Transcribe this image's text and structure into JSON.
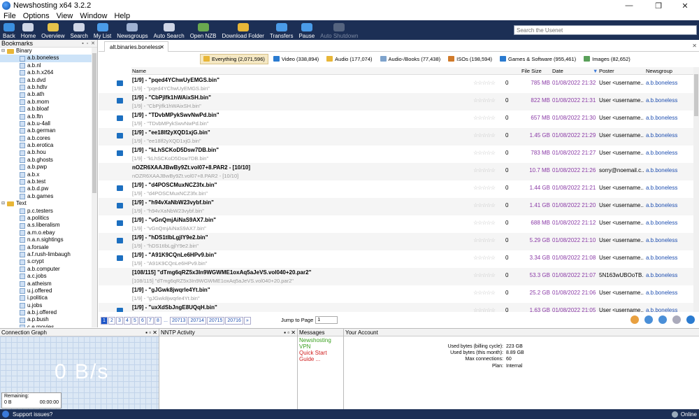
{
  "window": {
    "title": "Newshosting x64 3.2.2",
    "minimize": "—",
    "maximize": "❐",
    "close": "✕"
  },
  "menu": [
    "File",
    "Options",
    "View",
    "Window",
    "Help"
  ],
  "toolbar": {
    "buttons": [
      {
        "label": "Back",
        "color": "#3b8fe0"
      },
      {
        "label": "Home",
        "color": "#cfd6e6"
      },
      {
        "label": "Overview",
        "color": "#e6c34a"
      },
      {
        "label": "Search",
        "color": "#cfd6e6"
      },
      {
        "label": "My List",
        "color": "#4a9be8"
      },
      {
        "label": "Newsgroups",
        "color": "#9fb2d2"
      },
      {
        "label": "Auto Search",
        "color": "#cfd6e6"
      },
      {
        "label": "Open NZB",
        "color": "#6aa84f"
      },
      {
        "label": "Download Folder",
        "color": "#e6b637"
      },
      {
        "label": "Transfers",
        "color": "#4a9be8"
      },
      {
        "label": "Pause",
        "color": "#4a9be8"
      },
      {
        "label": "Auto Shutdown",
        "color": "#55647f",
        "disabled": true
      }
    ],
    "search_placeholder": "Search the Usenet"
  },
  "bookmarks": {
    "title": "Bookmarks",
    "controls": "▪ ▫ ✕",
    "groups": [
      {
        "label": "Binary",
        "toggle": "⊟",
        "items": [
          "a.b.boneless",
          "a.b.nl",
          "a.b.h.x264",
          "a.b.dvd",
          "a.b.hdtv",
          "a.b.ath",
          "a.b.mom",
          "a.b.bloaf",
          "a.b.ftn",
          "a.b.u-4all",
          "a.b.german",
          "a.b.cores",
          "a.b.erotica",
          "a.b.hou",
          "a.b.ghosts",
          "a.b.pwp",
          "a.b.x",
          "a.b.test",
          "a.b.d.pw",
          "a.b.games"
        ]
      },
      {
        "label": "Text",
        "toggle": "⊟",
        "items": [
          "p.c.testers",
          "a.politics",
          "a.s.liberalism",
          "a.m.o.ebay",
          "n.a.n.sightings",
          "a.forsale",
          "a.f.rush-limbaugh",
          "s.crypt",
          "a.b.computer",
          "a.c.jobs",
          "a.atheism",
          "u.j.offered",
          "i.politica",
          "u.jobs",
          "a.b.j.offered",
          "a.p.bush",
          "c.e.movies"
        ]
      }
    ],
    "selected": "a.b.boneless"
  },
  "tab": {
    "label": "alt.binaries.boneless",
    "close": "✕"
  },
  "filters": [
    {
      "label": "Everything (2,071,596)",
      "color": "#e8b637",
      "active": true
    },
    {
      "label": "Video (338,894)",
      "color": "#2b7bd0"
    },
    {
      "label": "Audio (177,074)",
      "color": "#e8b637"
    },
    {
      "label": "Audio-/Books (77,438)",
      "color": "#7ea3cc"
    },
    {
      "label": "ISOs (198,594)",
      "color": "#d07a2a"
    },
    {
      "label": "Games & Software (955,461)",
      "color": "#2b7bd0"
    },
    {
      "label": "Images (82,652)",
      "color": "#5aa05a"
    }
  ],
  "columns": {
    "name": "Name",
    "size": "File Size",
    "date": "Date",
    "sort": "▼",
    "poster": "Poster",
    "group": "Newsgroup"
  },
  "rows": [
    {
      "name": "[1/9] - \"pqed4YChwUyEMGS.bin\"",
      "sub": "[1/9] - \"pqed4YChwUyEMGS.bin\"",
      "count": "0",
      "size": "785 MB",
      "date": "01/08/2022 21:32",
      "poster": "User <username...",
      "group": "a.b.boneless",
      "icon": true
    },
    {
      "name": "[1/9] - \"CbPjIfk1hWAixSH.bin\"",
      "sub": "[1/9] - \"CbPjIfk1hWAixSH.bin\"",
      "count": "0",
      "size": "822 MB",
      "date": "01/08/2022 21:31",
      "poster": "User <username...",
      "group": "a.b.boneless",
      "icon": true
    },
    {
      "name": "[1/9] - \"TDvbMPykSwvNwPd.bin\"",
      "sub": "[1/9] - \"TDvbMPykSwvNwPd.bin\"",
      "count": "0",
      "size": "657 MB",
      "date": "01/08/2022 21:30",
      "poster": "User <username...",
      "group": "a.b.boneless",
      "icon": true
    },
    {
      "name": "[1/9] - \"ee18lf2yXQD1xjG.bin\"",
      "sub": "[1/9] - \"ee18lf2yXQD1xjG.bin\"",
      "count": "0",
      "size": "1.45 GB",
      "date": "01/08/2022 21:29",
      "poster": "User <username...",
      "group": "a.b.boneless",
      "icon": true
    },
    {
      "name": "[1/9] - \"kLhSCKoD5Dsw7DB.bin\"",
      "sub": "[1/9] - \"kLhSCKoD5Dsw7DB.bin\"",
      "count": "0",
      "size": "783 MB",
      "date": "01/08/2022 21:27",
      "poster": "User <username...",
      "group": "a.b.boneless",
      "icon": true
    },
    {
      "name": "nOZR6XAAJBwBy9Zt.vol07+8.PAR2 - [10/10]",
      "sub": "nOZR6XAAJBwBy9Zt.vol07+8.PAR2 - [10/10]",
      "count": "0",
      "size": "10.7 MB",
      "date": "01/08/2022 21:26",
      "poster": "sorry@noemail.c...",
      "group": "a.b.boneless",
      "icon": false
    },
    {
      "name": "[1/9] - \"d4POSCMuxNCZ3fx.bin\"",
      "sub": "[1/9] - \"d4POSCMuxNCZ3fx.bin\"",
      "count": "0",
      "size": "1.44 GB",
      "date": "01/08/2022 21:21",
      "poster": "User <username...",
      "group": "a.b.boneless",
      "icon": true
    },
    {
      "name": "[1/9] - \"h94vXaNbW23vybf.bin\"",
      "sub": "[1/9] - \"h94vXaNbW23vybf.bin\"",
      "count": "0",
      "size": "1.41 GB",
      "date": "01/08/2022 21:20",
      "poster": "User <username...",
      "group": "a.b.boneless",
      "icon": true
    },
    {
      "name": "[1/9] - \"vGnQmjAiNaS9AX7.bin\"",
      "sub": "[1/9] - \"vGnQmjAiNaS9AX7.bin\"",
      "count": "0",
      "size": "688 MB",
      "date": "01/08/2022 21:12",
      "poster": "User <username...",
      "group": "a.b.boneless",
      "icon": true
    },
    {
      "name": "[1/9] - \"hDS1tIbLgjlY9e2.bin\"",
      "sub": "[1/9] - \"hDS1tIbLgjlY9e2.bin\"",
      "count": "0",
      "size": "5.29 GB",
      "date": "01/08/2022 21:10",
      "poster": "User <username...",
      "group": "a.b.boneless",
      "icon": true
    },
    {
      "name": "[1/9] - \"A91K9CQnLe6HPv9.bin\"",
      "sub": "[1/9] - \"A91K9CQnLe6HPv9.bin\"",
      "count": "0",
      "size": "3.34 GB",
      "date": "01/08/2022 21:08",
      "poster": "User <username...",
      "group": "a.b.boneless",
      "icon": true
    },
    {
      "name": "[108/115] \"dTmg6qRZ5x3In9WGWME1oxAq5aJeVS.vol040+20.par2\"",
      "sub": "[108/115] \"dTmg6qRZ5x3In9WGWME1oxAq5aJeVS.vol040+20.par2\"",
      "count": "0",
      "size": "53.3 GB",
      "date": "01/08/2022 21:07",
      "poster": "5N163wUBOoTB...",
      "group": "a.b.boneless",
      "icon": false
    },
    {
      "name": "[1/9] - \"gJGwk8jwqrle4Yt.bin\"",
      "sub": "[1/9] - \"gJGwk8jwqrle4Yt.bin\"",
      "count": "0",
      "size": "25.2 GB",
      "date": "01/08/2022 21:06",
      "poster": "User <username...",
      "group": "a.b.boneless",
      "icon": false
    },
    {
      "name": "[1/9] - \"uxXdSbJngE8UQqH.bin\"",
      "sub": "",
      "count": "0",
      "size": "1.63 GB",
      "date": "01/08/2022 21:05",
      "poster": "User <username...",
      "group": "a.b.boneless",
      "icon": true
    }
  ],
  "pager": {
    "pages": [
      "1",
      "2",
      "3",
      "4",
      "5",
      "6",
      "7",
      "8"
    ],
    "ellipsis": "...",
    "tail": [
      "20713",
      "20714",
      "20715",
      "20716"
    ],
    "next": "»",
    "jump_label": "Jump to Page",
    "jump_value": "1"
  },
  "panes": {
    "connection": {
      "title": "Connection Graph",
      "rate": "0 B/s",
      "remaining_label": "Remaining:",
      "remaining_size": "0 B",
      "remaining_time": "00:00:00"
    },
    "nntp": {
      "title": "NNTP Activity"
    },
    "messages": {
      "title": "Messages",
      "items": [
        "Newshosting VPN",
        "Quick Start Guide ..."
      ]
    },
    "account": {
      "title": "Your Account",
      "rows": [
        {
          "k": "Used bytes (billing cycle):",
          "v": "223 GB"
        },
        {
          "k": "Used bytes (this month):",
          "v": "8.89 GB"
        },
        {
          "k": "Max connections:",
          "v": "60"
        },
        {
          "k": "Plan:",
          "v": "Internal"
        }
      ]
    },
    "controls": "▪ ▫ ✕"
  },
  "status": {
    "support": "Support issues?",
    "online": "Online"
  }
}
